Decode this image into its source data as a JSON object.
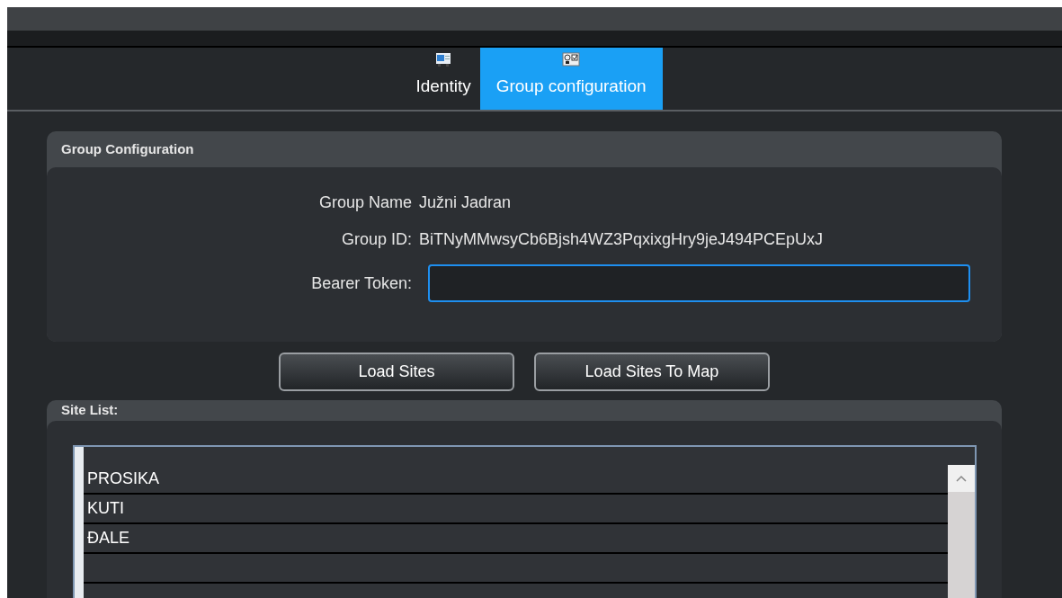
{
  "tabs": [
    {
      "label": "Identity",
      "selected": false,
      "kind": "identity"
    },
    {
      "label": "Group configuration",
      "selected": true,
      "kind": "group"
    }
  ],
  "group_configuration": {
    "title": "Group Configuration",
    "fields": [
      {
        "label": "Group Name",
        "kind": "text",
        "value": "Južni Jadran"
      },
      {
        "label": "Group ID:",
        "kind": "text",
        "value": "BiTNyMMwsyCb6Bjsh4WZ3PqxixgHry9jeJ494PCEpUxJ"
      },
      {
        "label": "Bearer Token:",
        "kind": "input"
      }
    ]
  },
  "buttons": [
    "Load Sites",
    "Load Sites To Map"
  ],
  "site_list": {
    "title": "Site List:",
    "rows": [
      "PROSIKA",
      "KUTI",
      "ĐALE"
    ]
  }
}
